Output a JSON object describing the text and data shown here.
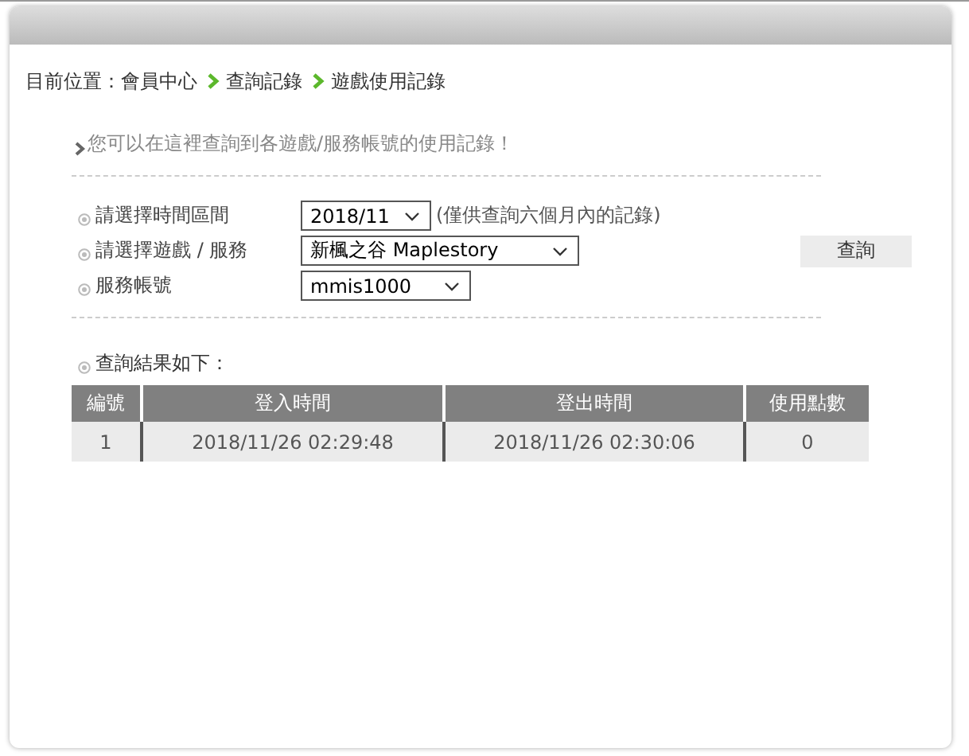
{
  "breadcrumb": {
    "prefix": "目前位置：會員中心",
    "items": [
      "查詢記錄",
      "遊戲使用記錄"
    ]
  },
  "intro": "您可以在這裡查詢到各遊戲/服務帳號的使用記錄！",
  "form": {
    "fields": [
      {
        "label": "請選擇時間區間",
        "value": "2018/11",
        "note": "(僅供查詢六個月內的記錄)"
      },
      {
        "label": "請選擇遊戲 / 服務",
        "value": "新楓之谷 Maplestory"
      },
      {
        "label": "服務帳號",
        "value": "mmis1000"
      }
    ],
    "submit": "查詢"
  },
  "results": {
    "title": "查詢結果如下：",
    "columns": [
      "編號",
      "登入時間",
      "登出時間",
      "使用點數"
    ],
    "rows": [
      [
        "1",
        "2018/11/26 02:29:48",
        "2018/11/26 02:30:06",
        "0"
      ]
    ]
  }
}
